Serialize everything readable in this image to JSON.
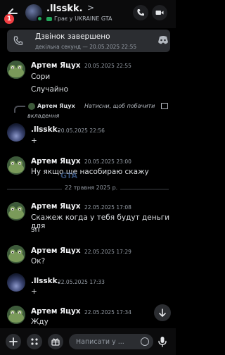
{
  "header": {
    "badge_count": "1",
    "name": ".llsskk.",
    "chevron": ">",
    "activity": "Грає у UKRAINE GTA"
  },
  "call": {
    "title": "Дзвінок завершено",
    "subtitle": "декілька секунд — 20.05.2025 22:55"
  },
  "messages": [
    {
      "author": "Артем Яцух",
      "time": "20.05.2025 22:55",
      "lines": [
        "Сори",
        "Случайно"
      ]
    },
    {
      "reply": {
        "author": "Артем Яцух",
        "text_1": "Натисни, щоб побачити",
        "text_2": "вкладення"
      },
      "author": ".llsskk.",
      "time": "20.05.2025 22:56",
      "lines": [
        "+"
      ]
    },
    {
      "author": "Артем Яцух",
      "time": "20.05.2025 23:00",
      "lines": [
        "Ну якщо ще насобираю скажу"
      ]
    },
    {
      "author": "Артем Яцух",
      "time": "22.05.2025 17:08",
      "lines": [
        "Скажеж когда у тебя будут деньги для",
        "зп"
      ]
    },
    {
      "author": "Артем Яцух",
      "time": "22.05.2025 17:29",
      "lines": [
        "Ок?"
      ]
    },
    {
      "author": ".llsskk.",
      "time": "22.05.2025 17:33",
      "lines": [
        "+"
      ]
    },
    {
      "author": "Артем Яцух",
      "time": "22.05.2025 17:34",
      "lines": [
        "Жду"
      ]
    }
  ],
  "date_divider": "22 травня 2025 р.",
  "watermark": "GTA",
  "composer": {
    "placeholder": "Написати у ..."
  },
  "colors": {
    "background": "#000000",
    "online": "#23a55a",
    "badge": "#f23f43"
  }
}
